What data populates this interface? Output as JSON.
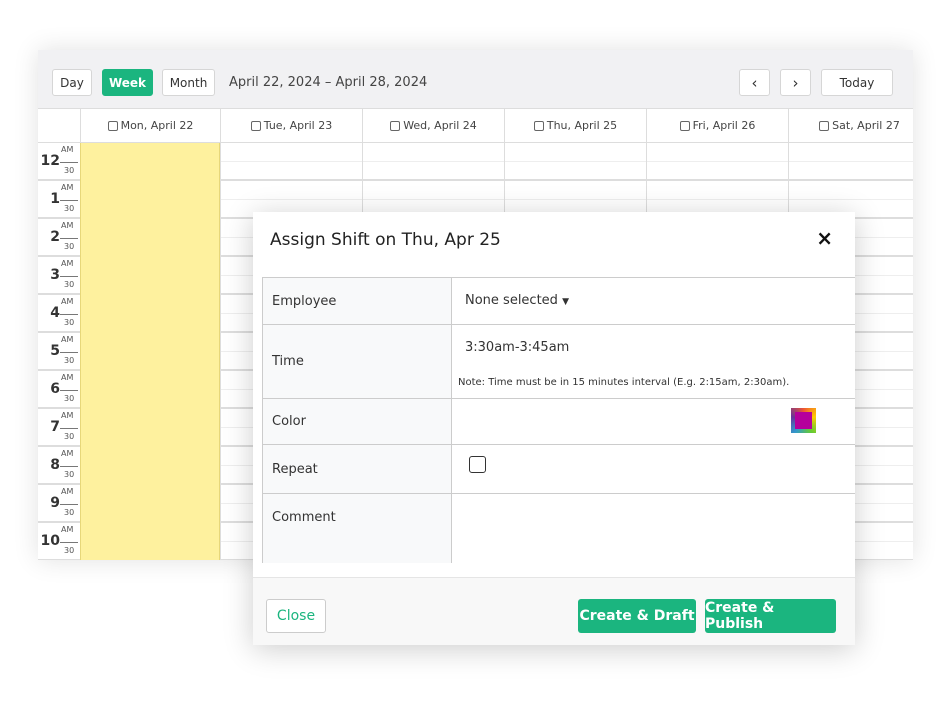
{
  "toolbar": {
    "day": "Day",
    "week": "Week",
    "month": "Month",
    "range": "April 22, 2024 – April 28, 2024",
    "prev": "‹",
    "next": "›",
    "today": "Today"
  },
  "columns": [
    "Mon, April 22",
    "Tue, April 23",
    "Wed, April 24",
    "Thu, April 25",
    "Fri, April 26",
    "Sat, April 27"
  ],
  "hours": [
    "12",
    "1",
    "2",
    "3",
    "4",
    "5",
    "6",
    "7",
    "8",
    "9",
    "10"
  ],
  "am_label": "AM",
  "half_label": "30",
  "highlight_color": "#fef19e",
  "accent": "#1bb57f",
  "modal": {
    "title": "Assign Shift on Thu, Apr 25",
    "close_icon": "×",
    "employee_label": "Employee",
    "employee_value": "None selected",
    "time_label": "Time",
    "time_value": "3:30am-3:45am",
    "time_note": "Note: Time must be in 15 minutes interval (E.g. 2:15am, 2:30am).",
    "color_label": "Color",
    "color_value": "#b5009c",
    "repeat_label": "Repeat",
    "repeat_checked": false,
    "comment_label": "Comment",
    "close_button": "Close",
    "draft_button": "Create & Draft",
    "publish_button": "Create & Publish"
  }
}
